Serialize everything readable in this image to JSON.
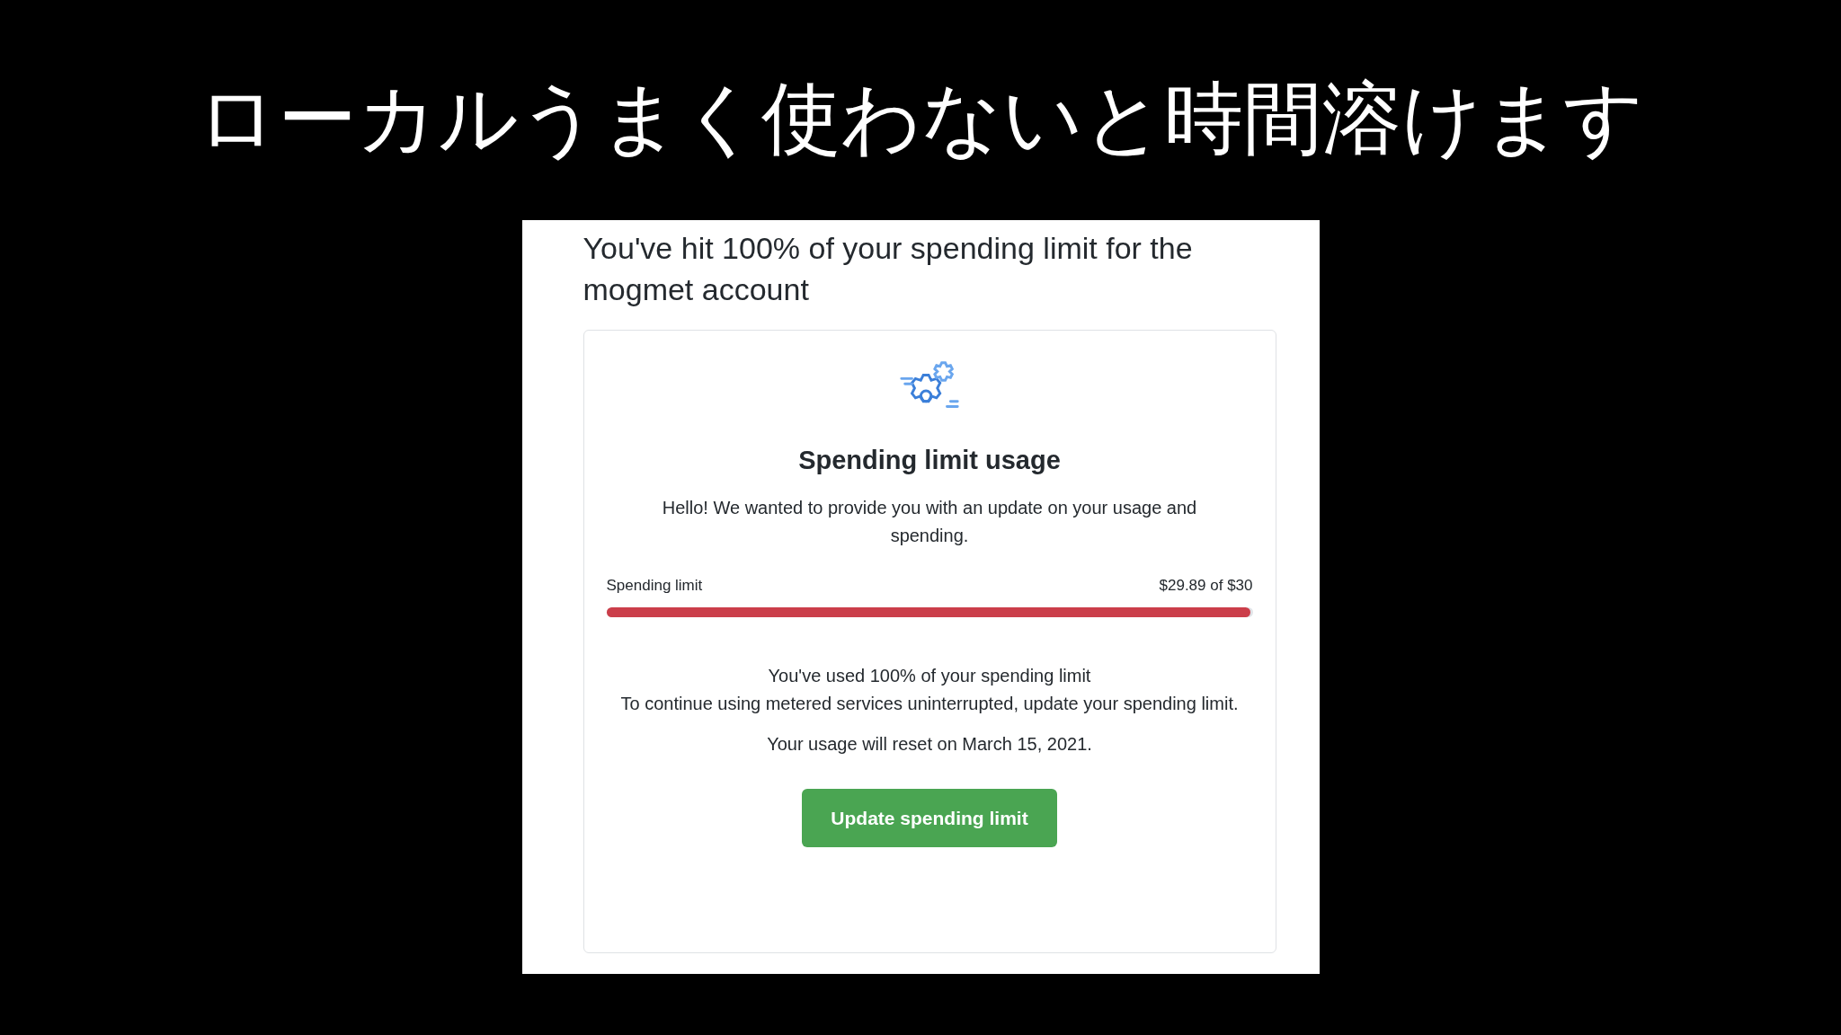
{
  "slide_title": "ローカルうまく使わないと時間溶けます",
  "email": {
    "heading": "You've hit 100% of your spending limit for the mogmet account",
    "card": {
      "title": "Spending limit usage",
      "intro": "Hello! We wanted to provide you with an update on your usage and spending.",
      "meter": {
        "label": "Spending limit",
        "reading": "$29.89 of $30",
        "level": 0.996
      },
      "used_line": "You've used 100% of your spending limit",
      "continue_line": "To continue using metered services uninterrupted, update your spending limit.",
      "reset_line": "Your usage will reset on March 15, 2021.",
      "button": "Update spending limit"
    }
  }
}
